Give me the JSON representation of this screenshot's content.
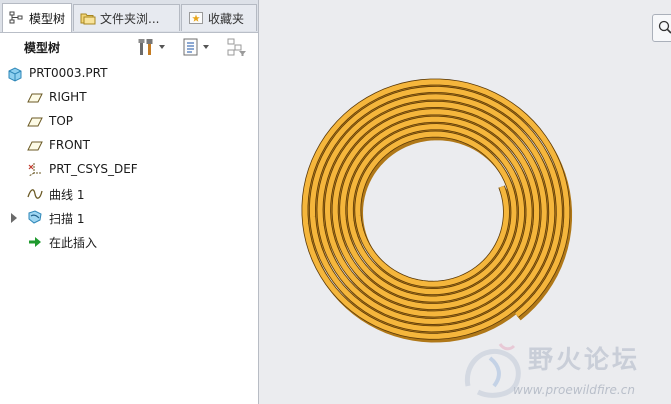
{
  "tabs": [
    {
      "label": "模型树",
      "icon": "model-tree-icon",
      "active": true
    },
    {
      "label": "文件夹浏...",
      "icon": "folder-browser-icon",
      "active": false
    },
    {
      "label": "收藏夹",
      "icon": "favorites-icon",
      "active": false
    }
  ],
  "toolbar": {
    "title": "模型树",
    "settings_icon": "tools-icon",
    "show_icon": "list-settings-icon",
    "filter_icon": "filter-icon"
  },
  "tree": {
    "items": [
      {
        "label": "PRT0003.PRT",
        "icon": "part-icon"
      },
      {
        "label": "RIGHT",
        "icon": "datum-plane-icon"
      },
      {
        "label": "TOP",
        "icon": "datum-plane-icon"
      },
      {
        "label": "FRONT",
        "icon": "datum-plane-icon"
      },
      {
        "label": "PRT_CSYS_DEF",
        "icon": "csys-icon"
      },
      {
        "label": "曲线 1",
        "icon": "curve-icon"
      },
      {
        "label": "扫描 1",
        "icon": "sweep-icon",
        "expandable": true
      },
      {
        "label": "在此插入",
        "icon": "insert-here-icon"
      }
    ]
  },
  "model": {
    "color": "#f5b63c",
    "edge_color": "#5c3a08",
    "shadow_color": "#b07818"
  },
  "watermark": {
    "title": "野火论坛",
    "url": "www.proewildfire.cn"
  }
}
